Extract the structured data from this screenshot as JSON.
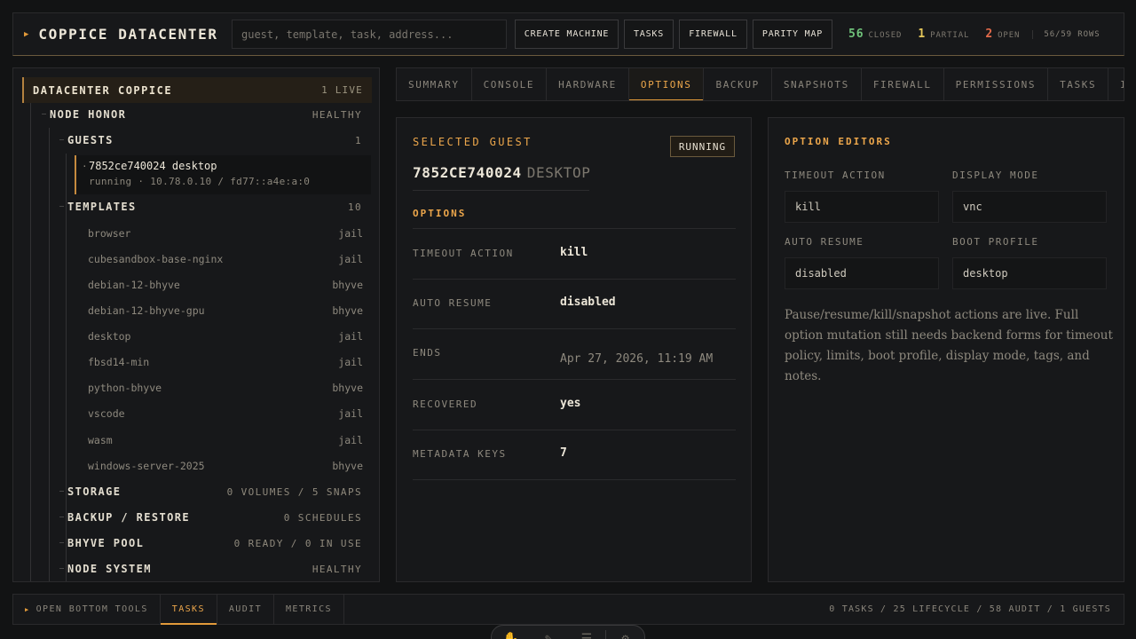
{
  "header": {
    "title": "COPPICE DATACENTER",
    "search_placeholder": "guest, template, task, address...",
    "buttons": {
      "create": "CREATE MACHINE",
      "tasks": "TASKS",
      "firewall": "FIREWALL",
      "parity": "PARITY MAP"
    },
    "stats": {
      "closed_n": "56",
      "closed_l": "CLOSED",
      "partial_n": "1",
      "partial_l": "PARTIAL",
      "open_n": "2",
      "open_l": "OPEN",
      "rows": "56/59 ROWS"
    },
    "colors": {
      "accent": "#e29a3a",
      "closed": "#6fc27a",
      "partial": "#e5c75a",
      "open": "#e36a4a"
    }
  },
  "tree": {
    "datacenter": {
      "name": "DATACENTER COPPICE",
      "meta": "1 LIVE"
    },
    "node": {
      "name": "NODE HONOR",
      "meta": "HEALTHY"
    },
    "guests": {
      "name": "GUESTS",
      "meta": "1"
    },
    "guest": {
      "name": "7852ce740024 desktop",
      "sub": "running · 10.78.0.10 / fd77::a4e:a:0"
    },
    "templates": {
      "name": "TEMPLATES",
      "meta": "10"
    },
    "template_items": [
      {
        "name": "browser",
        "kind": "jail"
      },
      {
        "name": "cubesandbox-base-nginx",
        "kind": "jail"
      },
      {
        "name": "debian-12-bhyve",
        "kind": "bhyve"
      },
      {
        "name": "debian-12-bhyve-gpu",
        "kind": "bhyve"
      },
      {
        "name": "desktop",
        "kind": "jail"
      },
      {
        "name": "fbsd14-min",
        "kind": "jail"
      },
      {
        "name": "python-bhyve",
        "kind": "bhyve"
      },
      {
        "name": "vscode",
        "kind": "jail"
      },
      {
        "name": "wasm",
        "kind": "jail"
      },
      {
        "name": "windows-server-2025",
        "kind": "bhyve"
      }
    ],
    "storage": {
      "name": "STORAGE",
      "meta": "0 VOLUMES / 5 SNAPS"
    },
    "backup": {
      "name": "BACKUP / RESTORE",
      "meta": "0 SCHEDULES"
    },
    "pool": {
      "name": "BHYVE POOL",
      "meta": "0 READY / 0 IN USE"
    },
    "system": {
      "name": "NODE SYSTEM",
      "meta": "HEALTHY"
    }
  },
  "tabs": [
    "SUMMARY",
    "CONSOLE",
    "HARDWARE",
    "OPTIONS",
    "BACKUP",
    "SNAPSHOTS",
    "FIREWALL",
    "PERMISSIONS",
    "TASKS",
    "I"
  ],
  "active_tab": "OPTIONS",
  "selected": {
    "heading": "SELECTED GUEST",
    "status": "RUNNING",
    "guest_id": "7852CE740024",
    "template": "DESKTOP",
    "section": "OPTIONS",
    "rows": [
      {
        "key": "TIMEOUT ACTION",
        "value": "kill"
      },
      {
        "key": "AUTO RESUME",
        "value": "disabled"
      },
      {
        "key": "ENDS",
        "value": "Apr 27, 2026, 11:19 AM"
      },
      {
        "key": "RECOVERED",
        "value": "yes"
      },
      {
        "key": "METADATA KEYS",
        "value": "7"
      }
    ]
  },
  "editors": {
    "heading": "OPTION EDITORS",
    "timeout_label": "TIMEOUT ACTION",
    "timeout_value": "kill",
    "display_label": "DISPLAY MODE",
    "display_value": "vnc",
    "resume_label": "AUTO RESUME",
    "resume_value": "disabled",
    "boot_label": "BOOT PROFILE",
    "boot_value": "desktop",
    "note": "Pause/resume/kill/snapshot actions are live. Full option mutation still needs backend forms for timeout policy, limits, boot profile, display mode, tags, and notes."
  },
  "bottom": {
    "open_tools": "OPEN BOTTOM TOOLS",
    "tabs": [
      "TASKS",
      "AUDIT",
      "METRICS"
    ],
    "active": "TASKS",
    "summary": "0 TASKS / 25 LIFECYCLE / 58 AUDIT / 1 GUESTS"
  }
}
